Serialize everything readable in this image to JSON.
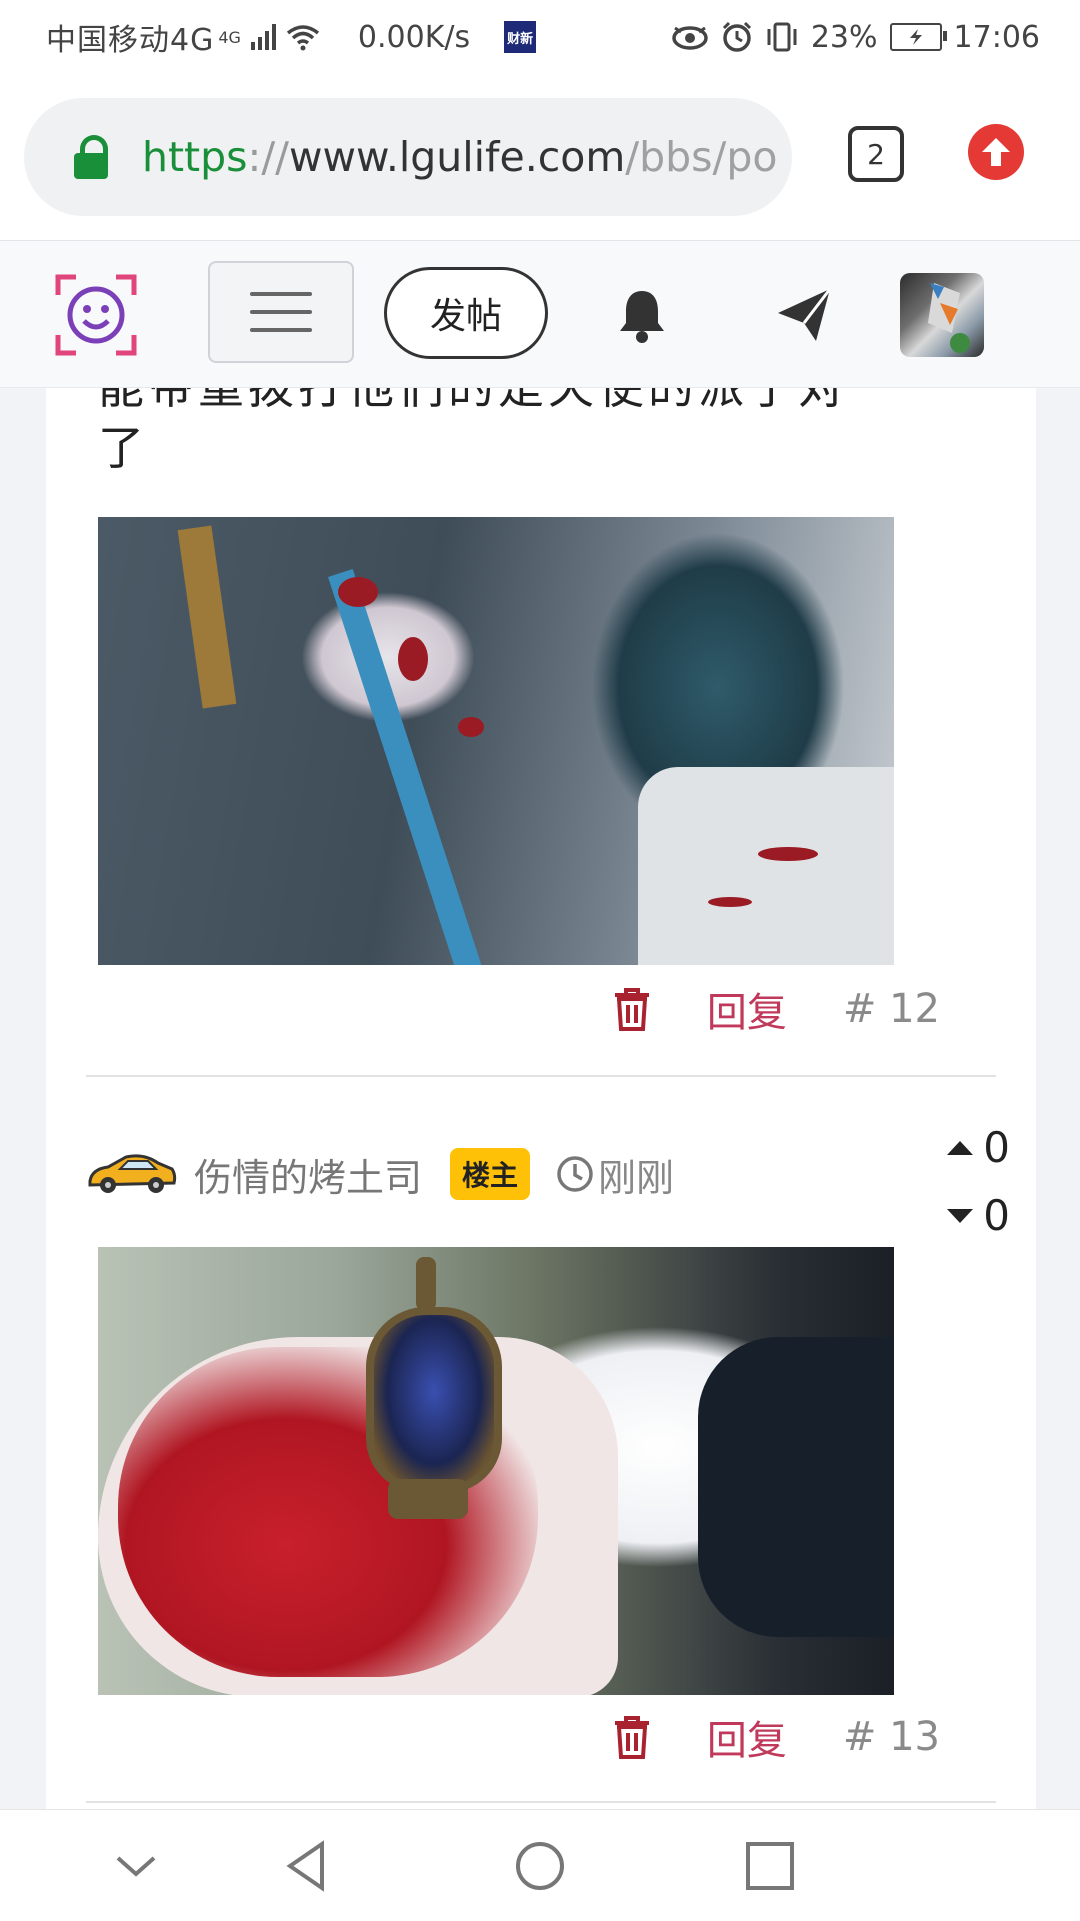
{
  "status_bar": {
    "carrier": "中国移动4G",
    "net_sup": "4G",
    "speed": "0.00K/s",
    "news_app": "财新",
    "battery": "23%",
    "time": "17:06",
    "icons": [
      "signal-icon",
      "wifi-icon",
      "eye-icon",
      "alarm-icon",
      "vibrate-icon",
      "battery-icon"
    ]
  },
  "browser": {
    "url": {
      "scheme": "https",
      "sep": "://",
      "host": "www.lgulife.com",
      "path": "/bbs/po"
    },
    "tab_count": "2",
    "colors": {
      "lock": "#1a8f3a",
      "upload": "#e53935"
    }
  },
  "header": {
    "post_button": "发帖",
    "icons": [
      "logo-icon",
      "menu-icon",
      "bell-icon",
      "send-icon",
      "avatar"
    ]
  },
  "posts": [
    {
      "text_tail_cut": "能带重拨打他们的是天使的派了对",
      "text_tail": "了",
      "reply_label": "回复",
      "floor": "# 12"
    },
    {
      "username": "伤情的烤土司",
      "badge": "楼主",
      "time": "刚刚",
      "upvotes": "0",
      "downvotes": "0",
      "reply_label": "回复",
      "floor": "# 13"
    }
  ],
  "colors": {
    "accent": "#c0395b",
    "badge": "#ffc107",
    "trash": "#a8232f"
  }
}
